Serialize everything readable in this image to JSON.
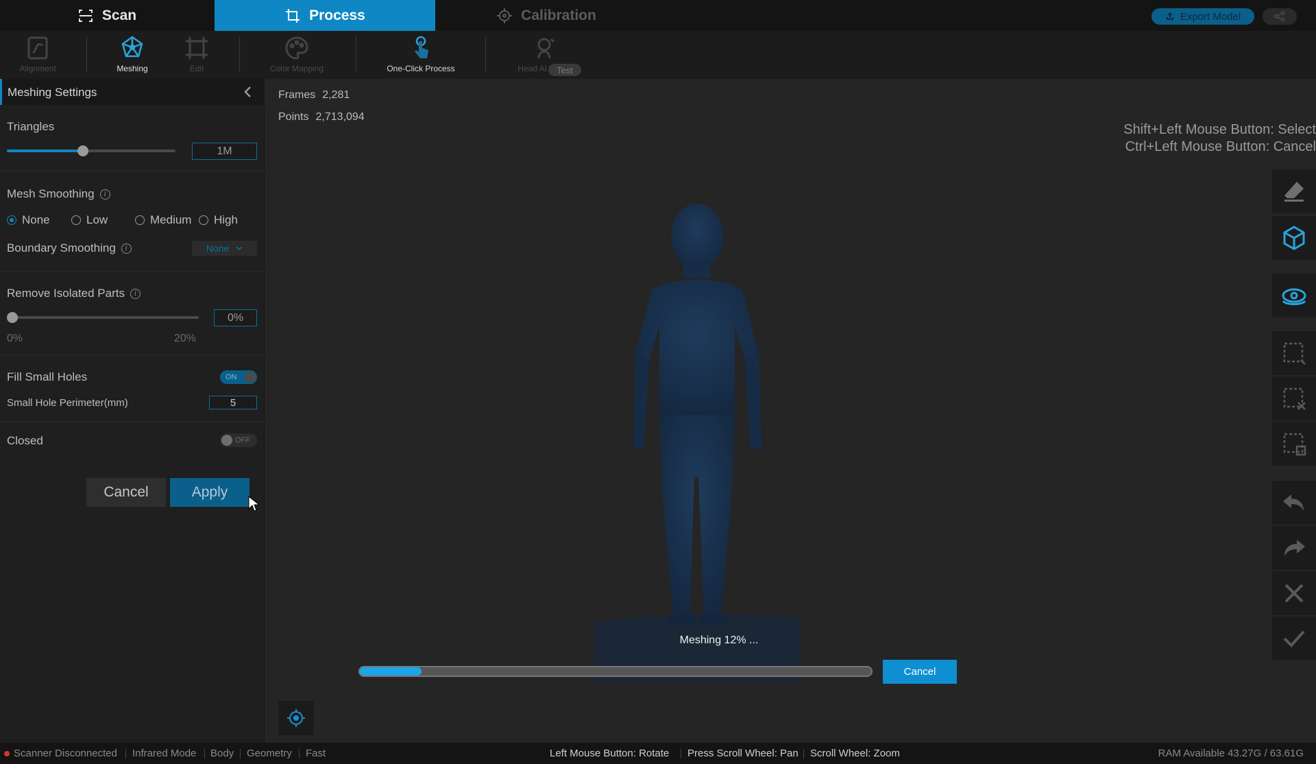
{
  "top_tabs": {
    "scan": "Scan",
    "process": "Process",
    "calibration": "Calibration"
  },
  "header_buttons": {
    "export": "Export Model"
  },
  "toolbar": {
    "alignment": "Alignment",
    "meshing": "Meshing",
    "edit": "Edit",
    "color_mapping": "Color Mapping",
    "one_click": "One-Click Process",
    "head_ai": "Head AI Repair",
    "test_badge": "Test"
  },
  "panel": {
    "title": "Meshing Settings",
    "triangles": {
      "label": "Triangles",
      "value": "1M",
      "slider_fraction": 0.45
    },
    "mesh_smoothing": {
      "label": "Mesh Smoothing",
      "options": [
        "None",
        "Low",
        "Medium",
        "High"
      ],
      "selected": "None"
    },
    "boundary_smoothing": {
      "label": "Boundary Smoothing",
      "value": "None"
    },
    "remove_isolated": {
      "label": "Remove Isolated Parts",
      "value": "0%",
      "min_label": "0%",
      "max_label": "20%",
      "slider_fraction": 0.0
    },
    "fill_small_holes": {
      "label": "Fill Small Holes",
      "toggle": "ON"
    },
    "small_hole_perimeter": {
      "label": "Small Hole Perimeter(mm)",
      "value": "5"
    },
    "closed": {
      "label": "Closed",
      "toggle": "OFF"
    },
    "cancel": "Cancel",
    "apply": "Apply"
  },
  "viewport": {
    "frames_label": "Frames",
    "frames_value": "2,281",
    "points_label": "Points",
    "points_value": "2,713,094",
    "hint_line1": "Shift+Left Mouse Button: Select",
    "hint_line2": "Ctrl+Left Mouse Button: Cancel",
    "progress_text": "Meshing 12% ...",
    "progress_fraction": 0.12,
    "progress_cancel": "Cancel"
  },
  "statusbar": {
    "scanner": "Scanner Disconnected",
    "mode": "Infrared Mode",
    "body": "Body",
    "geometry": "Geometry",
    "fast": "Fast",
    "rotate": "Left Mouse Button: Rotate",
    "pan": "Press Scroll Wheel: Pan",
    "zoom": "Scroll Wheel: Zoom",
    "ram": "RAM Available 43.27G / 63.61G"
  },
  "colors": {
    "accent": "#0e87c4",
    "progress": "#1aa6e8",
    "error": "#d23a2a"
  }
}
